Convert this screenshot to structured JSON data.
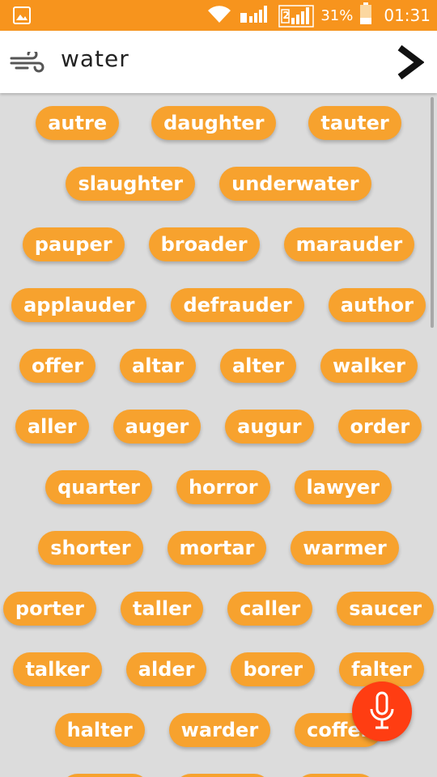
{
  "status_bar": {
    "battery_percent": "31%",
    "time": "01:31",
    "sim2_label": "2"
  },
  "search": {
    "query": "water"
  },
  "results": {
    "rows": [
      [
        "autre",
        "daughter",
        "tauter"
      ],
      [
        "slaughter",
        "underwater"
      ],
      [
        "pauper",
        "broader",
        "marauder"
      ],
      [
        "applauder",
        "defrauder",
        "author"
      ],
      [
        "offer",
        "altar",
        "alter",
        "walker"
      ],
      [
        "aller",
        "auger",
        "augur",
        "order"
      ],
      [
        "quarter",
        "horror",
        "lawyer"
      ],
      [
        "shorter",
        "mortar",
        "warmer"
      ],
      [
        "porter",
        "taller",
        "caller",
        "saucer"
      ],
      [
        "talker",
        "alder",
        "borer",
        "falter"
      ],
      [
        "halter",
        "warder",
        "coffer"
      ]
    ]
  },
  "colors": {
    "status_bar": "#f7941d",
    "pill": "#f7a22e",
    "background": "#dcdcdc",
    "mic_button": "#ff3d12"
  },
  "icons": {
    "menu": "wind-icon",
    "go": "chevron-right-icon",
    "mic": "microphone-icon"
  }
}
